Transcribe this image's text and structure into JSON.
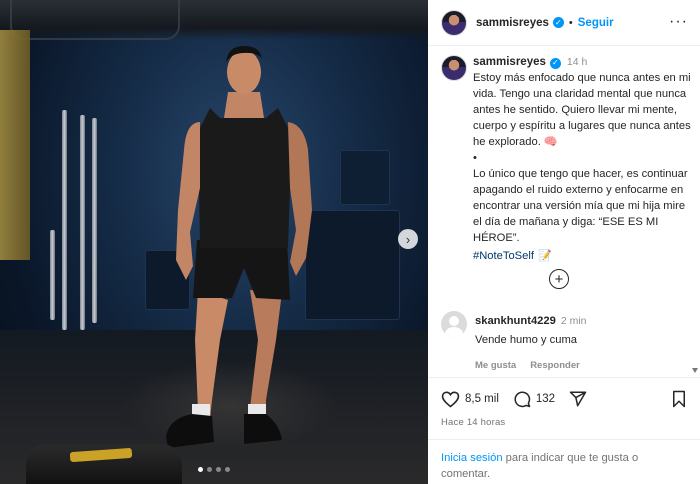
{
  "post": {
    "username": "sammisreyes",
    "follow_label": "Seguir",
    "more_label": "···",
    "separator": "•"
  },
  "caption": {
    "username": "sammisreyes",
    "time": "14 h",
    "paragraph1": "Estoy más enfocado que nunca antes en mi vida. Tengo una claridad mental que nunca antes he sentido. Quiero llevar mi mente, cuerpo y espíritu a lugares que nunca antes he explorado.",
    "emoji1": "🧠",
    "bullet": "•",
    "paragraph2": "Lo único que tengo que hacer, es continuar apagando el ruido externo y enfocarme en encontrar una versión mía que mi hija mire el día de mañana y diga: “ESE ES MI HÉROE”.",
    "hashtag": "#NoteToSelf",
    "emoji2": "📝"
  },
  "comment": {
    "username": "skankhunt4229",
    "time": "2 min",
    "text": "Vende humo y cuma",
    "like_label": "Me gusta",
    "reply_label": "Responder"
  },
  "actions": {
    "likes": "8,5 mil",
    "comments": "132",
    "posted": "Hace 14 horas"
  },
  "login": {
    "link": "Inicia sesión",
    "rest": " para indicar que te gusta o comentar."
  },
  "carousel": {
    "next_glyph": "›",
    "dots": 4,
    "active": 0
  },
  "colors": {
    "accent": "#0095f6",
    "hashtag": "#00376b",
    "muted": "#8e8e8e"
  },
  "icons": [
    "more-icon",
    "verified-icon",
    "plus-circle-icon",
    "heart-icon",
    "comment-icon",
    "share-icon",
    "bookmark-icon",
    "chevron-right-icon"
  ]
}
